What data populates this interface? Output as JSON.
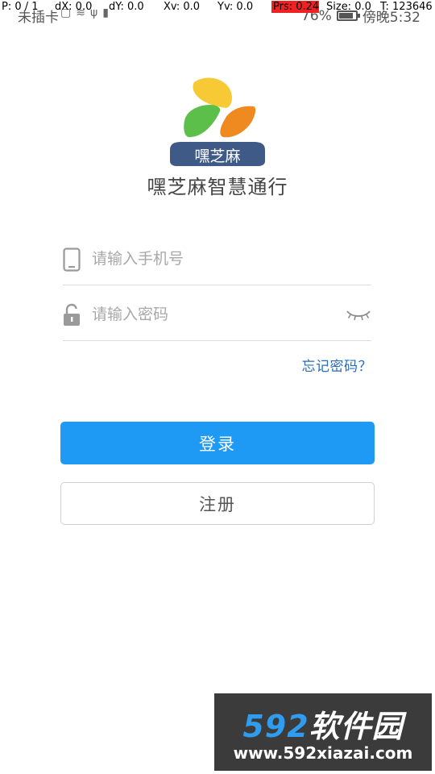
{
  "status_bar": {
    "carrier": "未插卡",
    "battery_percent": "76%",
    "battery_level": 0.76,
    "time": "傍晚5:32"
  },
  "debug_overlay": {
    "pointer": "P: 0 / 1",
    "dx": "dX: 0.0",
    "dy": "dY: 0.0",
    "xv": "Xv: 0.0",
    "yv": "Yv: 0.0",
    "prs": "Prs: 0.24",
    "size": "Size: 0.0",
    "t": "T: 123646"
  },
  "app": {
    "logo_text": "嘿芝麻",
    "title": "嘿芝麻智慧通行",
    "logo_colors": {
      "yellow": "#f7c934",
      "green": "#5bbf4a",
      "orange": "#ee8a1f",
      "banner": "#3f5a86"
    }
  },
  "form": {
    "phone": {
      "placeholder": "请输入手机号",
      "value": "",
      "icon": "phone-icon"
    },
    "password": {
      "placeholder": "请输入密码",
      "value": "",
      "icon": "lock-icon",
      "toggle_icon": "eye-closed-icon"
    },
    "forgot_password": "忘记密码？",
    "login_label": "登录",
    "register_label": "注册"
  },
  "colors": {
    "primary": "#1e9af5",
    "link": "#2a6db8"
  },
  "watermark": {
    "number": "592",
    "brand": "软件园",
    "url": "www.592xiazai.com"
  }
}
